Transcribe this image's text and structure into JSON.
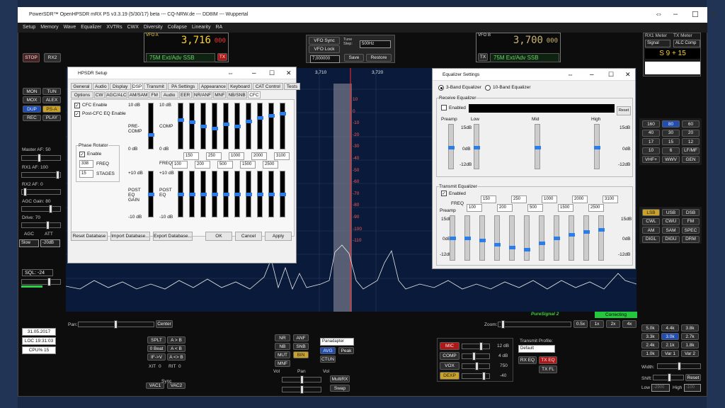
{
  "window": {
    "title": "PowerSDR™ OpenHPSDR mRX PS v3.3.19 (5/30/17) beta  ---  CQ-NRW.de  ---  DD8IM  ---  Wuppertal"
  },
  "menu": [
    "Setup",
    "Memory",
    "Wave",
    "Equalizer",
    "XVTRs",
    "CWX",
    "Diversity",
    "Collapse",
    "Linearity",
    "RA"
  ],
  "vfoa": {
    "label": "VFO A",
    "freq": "3,716",
    "freq_small": "000",
    "mode": "75M Ext/Adv SSB",
    "tx": "TX"
  },
  "vfob": {
    "label": "VFO B",
    "freq": "3,700",
    "freq_small": "000",
    "mode": "75M Ext/Adv SSB",
    "tx": "TX"
  },
  "center": {
    "vfo_sync": "VFO Sync",
    "vfo_lock": "VFO Lock",
    "tune_step_label": "Tune Step:",
    "tune_step": "500Hz",
    "freq": "7,000000",
    "save": "Save",
    "restore": "Restore"
  },
  "left": {
    "stop": "STOP",
    "rx2": "RX2",
    "mon": "MON",
    "tun": "TUN",
    "mox": "MOX",
    "alex": "ALEX",
    "dup": "DUP",
    "psa": "PS-A",
    "rec": "REC",
    "play": "PLAY",
    "master": "Master AF:  50",
    "rx1af": "RX1 AF:  100",
    "rx2af": "RX2 AF:  0",
    "agcgain": "AGC Gain:  80",
    "drive": "Drive:  70",
    "agc": "AGC",
    "att": "ATT",
    "agc_val": "Slow",
    "att_val": "-20dB",
    "sql": "SQL:  -24",
    "date": "31.05.2017",
    "loc": "LOC 19:31:03",
    "cpu": "CPU%  15"
  },
  "meters": {
    "rx1": "RX1 Meter",
    "tx": "TX Meter",
    "sig": "Signal",
    "alc": "ALC Comp",
    "reading": "S 9 + 15"
  },
  "bands": [
    "160",
    "80",
    "60",
    "40",
    "30",
    "20",
    "17",
    "15",
    "12",
    "10",
    "6",
    "LF/MF",
    "VHF+",
    "WWV",
    "GEN"
  ],
  "modes": [
    "LSB",
    "USB",
    "DSB",
    "CWL",
    "CWU",
    "FM",
    "AM",
    "SAM",
    "SPEC",
    "DIGL",
    "DIGU",
    "DRM"
  ],
  "filters": [
    "5.0k",
    "4.4k",
    "3.8k",
    "3.3k",
    "3.0k",
    "2.7k",
    "2.4k",
    "2.1k",
    "1.8k",
    "1.0k",
    "Var 1",
    "Var 2"
  ],
  "bottom": {
    "pan": "Pan:",
    "center": "Center",
    "zoom": "Zoom:",
    "z05": "0.5x",
    "z1": "1x",
    "z2": "2x",
    "z4": "4x",
    "puresignal": "PureSignal 2",
    "correcting": "Correcting",
    "split": "SPLT",
    "ab": "A > B",
    "zerobeat": "0 Beat",
    "ba": "A < B",
    "ifv": "IF->V",
    "ab2": "A <> B",
    "xit": "XIT",
    "xitv": "0",
    "rit": "RIT",
    "ritv": "0",
    "sync": "Sync",
    "vac1": "VAC1",
    "vac2": "VAC2",
    "nr": "NR",
    "anf": "ANF",
    "nb": "NB",
    "snb": "SNB",
    "mut": "MUT",
    "bin": "BIN",
    "mnf": "MNF",
    "display": "Panadapter",
    "avg": "AVG",
    "peak": "Peak",
    "ctun": "CTUN",
    "vol": "Vol",
    "panl": "Pan",
    "vol2": "Vol",
    "multirx": "MultiRX",
    "swap": "Swap",
    "mic": "MIC",
    "mic_db": "12 dB",
    "comp": "COMP",
    "comp_db": "4 dB",
    "vox": "VOX",
    "vox_v": "750",
    "dexp": "DEXP",
    "dexp_v": "-40",
    "txprofile": "Transmit Profile:",
    "txprofile_v": "Default",
    "rxeq": "RX EQ",
    "txeq": "TX EQ",
    "txfl": "TX FL",
    "width": "Width:",
    "shift": "Shift:",
    "reset": "Reset",
    "low": "Low",
    "lowv": "-2900",
    "high": "High",
    "highv": "-100"
  },
  "pan_scale": {
    "freqs": [
      "3,710",
      "3,720"
    ],
    "db": [
      "10",
      "0",
      "-10",
      "-20",
      "-30",
      "-40",
      "-50",
      "-60",
      "-70",
      "-80",
      "-90",
      "-100",
      "-110"
    ]
  },
  "hpsdr": {
    "title": "HPSDR Setup",
    "tabs1": [
      "General",
      "Audio",
      "Display",
      "DSP",
      "Transmit",
      "PA Settings",
      "Appearance",
      "Keyboard",
      "CAT Control",
      "Tests"
    ],
    "tabs2": [
      "Options",
      "CW",
      "AGC/ALC",
      "AM/SAM",
      "FM",
      "Audio",
      "EER",
      "NR/ANF",
      "MNF",
      "NB/SNB",
      "CFC"
    ],
    "cfc_enable": "CFC Enable",
    "post_cfc": "Post-CFC EQ Enable",
    "phase_rot": "Phase Rotator",
    "enable": "Enable",
    "freq_val": "338",
    "freq_lbl": "FREQ",
    "stages_val": "15",
    "stages_lbl": "STAGES",
    "pre_comp": "PRE-COMP",
    "comp": "COMP",
    "freq": "FREQ",
    "post_eq_gain": "POST EQ GAIN",
    "post_eq": "POST EQ",
    "db10": "10 dB",
    "db0": "0 dB",
    "dbp10": "+10 dB",
    "dbm10": "-10 dB",
    "freq_top": [
      "150",
      "250",
      "1000",
      "2000",
      "3100"
    ],
    "freq_bot": [
      "100",
      "200",
      "500",
      "1500",
      "2500"
    ],
    "reset_db": "Reset Database",
    "import_db": "Import Database...",
    "export_db": "Export Database...",
    "ok": "OK",
    "cancel": "Cancel",
    "apply": "Apply",
    "comp_levels": [
      0.35,
      0.4,
      0.5,
      0.55,
      0.45,
      0.5,
      0.38,
      0.3,
      0.25,
      0.2
    ],
    "post_levels": [
      0.5,
      0.5,
      0.5,
      0.5,
      0.5,
      0.5,
      0.5,
      0.5,
      0.5,
      0.5
    ]
  },
  "eq": {
    "title": "Equalizer Settings",
    "band3": "3-Band Equalizer",
    "band10": "10-Band Equalizer",
    "rx": "Receive Equalizer",
    "enabled": "Enabled",
    "reset": "Reset",
    "preamp": "Preamp",
    "low": "Low",
    "mid": "Mid",
    "high": "High",
    "db15": "15dB",
    "db0": "0dB",
    "dbm12": "-12dB",
    "tx": "Transmit Equalizer",
    "tx_enabled": "Enabled",
    "freq": "FREQ",
    "tx_top": [
      "150",
      "250",
      "1000",
      "2000",
      "3100"
    ],
    "tx_bot": [
      "100",
      "200",
      "500",
      "1500",
      "2500"
    ],
    "tx_levels": [
      0.5,
      0.5,
      0.55,
      0.65,
      0.72,
      0.78,
      0.62,
      0.5,
      0.42,
      0.35,
      0.3
    ]
  }
}
